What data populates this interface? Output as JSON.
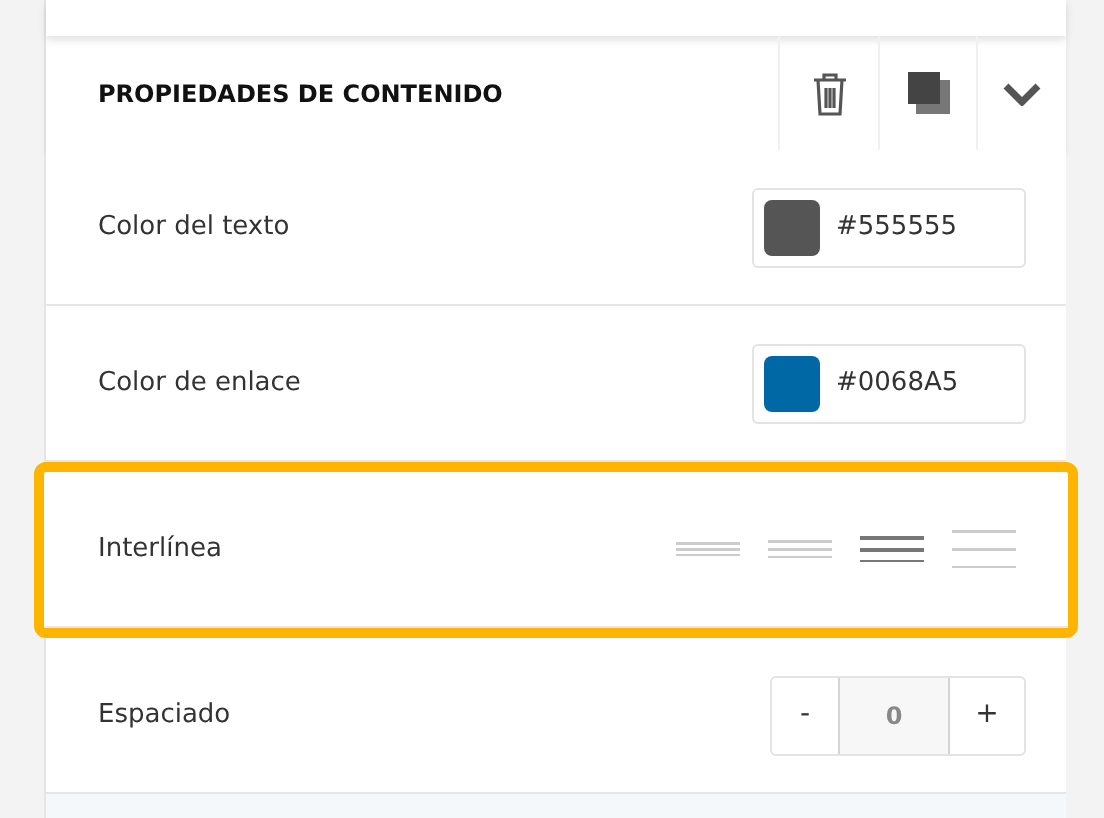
{
  "panel": {
    "title": "PROPIEDADES DE CONTENIDO"
  },
  "rows": [
    {
      "kind": "color",
      "label": "Color del texto",
      "value": "#555555",
      "color": "#555555",
      "highlighted": false
    },
    {
      "kind": "color",
      "label": "Color de enlace",
      "value": "#0068A5",
      "color": "#0068a5",
      "highlighted": false
    },
    {
      "kind": "lines",
      "label": "Interlínea",
      "highlighted": true,
      "options": [
        {
          "selected": false
        },
        {
          "selected": false
        },
        {
          "selected": true
        },
        {
          "selected": false
        }
      ]
    },
    {
      "kind": "stepper",
      "label": "Espaciado",
      "highlighted": false,
      "minus": "-",
      "value": "0",
      "plus": "+"
    }
  ]
}
